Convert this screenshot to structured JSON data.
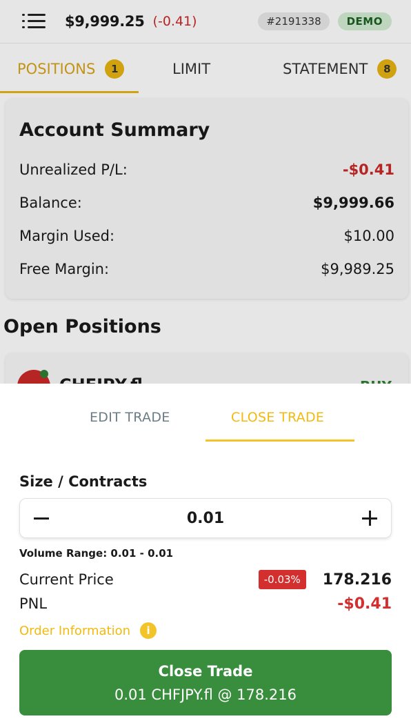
{
  "header": {
    "balance": "$9,999.25",
    "balance_change": "(-0.41)",
    "account_id": "#2191338",
    "mode_badge": "DEMO"
  },
  "tabs": [
    {
      "label": "POSITIONS",
      "badge": "1"
    },
    {
      "label": "LIMIT"
    },
    {
      "label": "STATEMENT",
      "badge": "8"
    }
  ],
  "account_summary": {
    "title": "Account Summary",
    "rows": [
      {
        "label": "Unrealized P/L:",
        "value": "-$0.41"
      },
      {
        "label": "Balance:",
        "value": "$9,999.66"
      },
      {
        "label": "Margin Used:",
        "value": "$10.00"
      },
      {
        "label": "Free Margin:",
        "value": "$9,989.25"
      }
    ]
  },
  "open_positions": {
    "title": "Open Positions",
    "items": [
      {
        "symbol": "CHFJPY.fl",
        "side": "BUY"
      }
    ]
  },
  "sheet": {
    "tabs": [
      "EDIT TRADE",
      "CLOSE TRADE"
    ],
    "active_tab": "CLOSE TRADE",
    "size_label": "Size / Contracts",
    "size_value": "0.01",
    "volume_range": "Volume Range: 0.01 - 0.01",
    "current_price_label": "Current Price",
    "price_change": "-0.03%",
    "current_price": "178.216",
    "pnl_label": "PNL",
    "pnl_value": "-$0.41",
    "order_info_label": "Order Information",
    "close_button": {
      "title": "Close Trade",
      "subtitle": "0.01 CHFJPY.fl @ 178.216"
    }
  },
  "colors": {
    "accent": "#f2b90f",
    "negative": "#d32f2f",
    "positive": "#388e3c"
  }
}
